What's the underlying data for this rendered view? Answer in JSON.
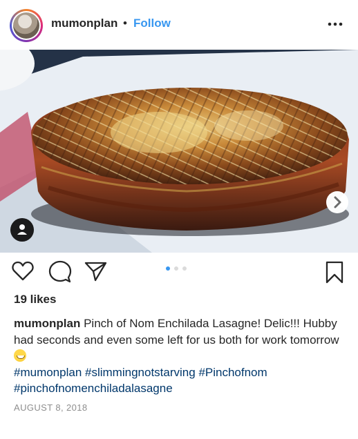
{
  "post": {
    "username": "mumonplan",
    "separator": "•",
    "follow_label": "Follow",
    "more_icon": "more-horizontal-icon",
    "likes": "19 likes",
    "caption_username": "mumonplan",
    "caption_text": "Pinch of Nom Enchilada Lasagne! Delic!!! Hubby had seconds and even some left for us both for work tomorrow",
    "caption_emoji": "grinning-face-emoji",
    "hashtags": [
      "#mumonplan",
      "#slimmingnotstarving",
      "#Pinchofnom",
      "#pinchofnomenchiladalasagne"
    ],
    "date": "AUGUST 8, 2018",
    "carousel": {
      "current": 1,
      "total": 3
    }
  },
  "icons": {
    "like": "heart-icon",
    "comment": "comment-icon",
    "share": "share-icon",
    "save": "bookmark-icon",
    "next": "chevron-right-icon",
    "tag": "user-tag-icon"
  },
  "colors": {
    "link_blue": "#3897f0",
    "hashtag": "#00376b",
    "text": "#262626",
    "muted": "#8e8e8e"
  }
}
